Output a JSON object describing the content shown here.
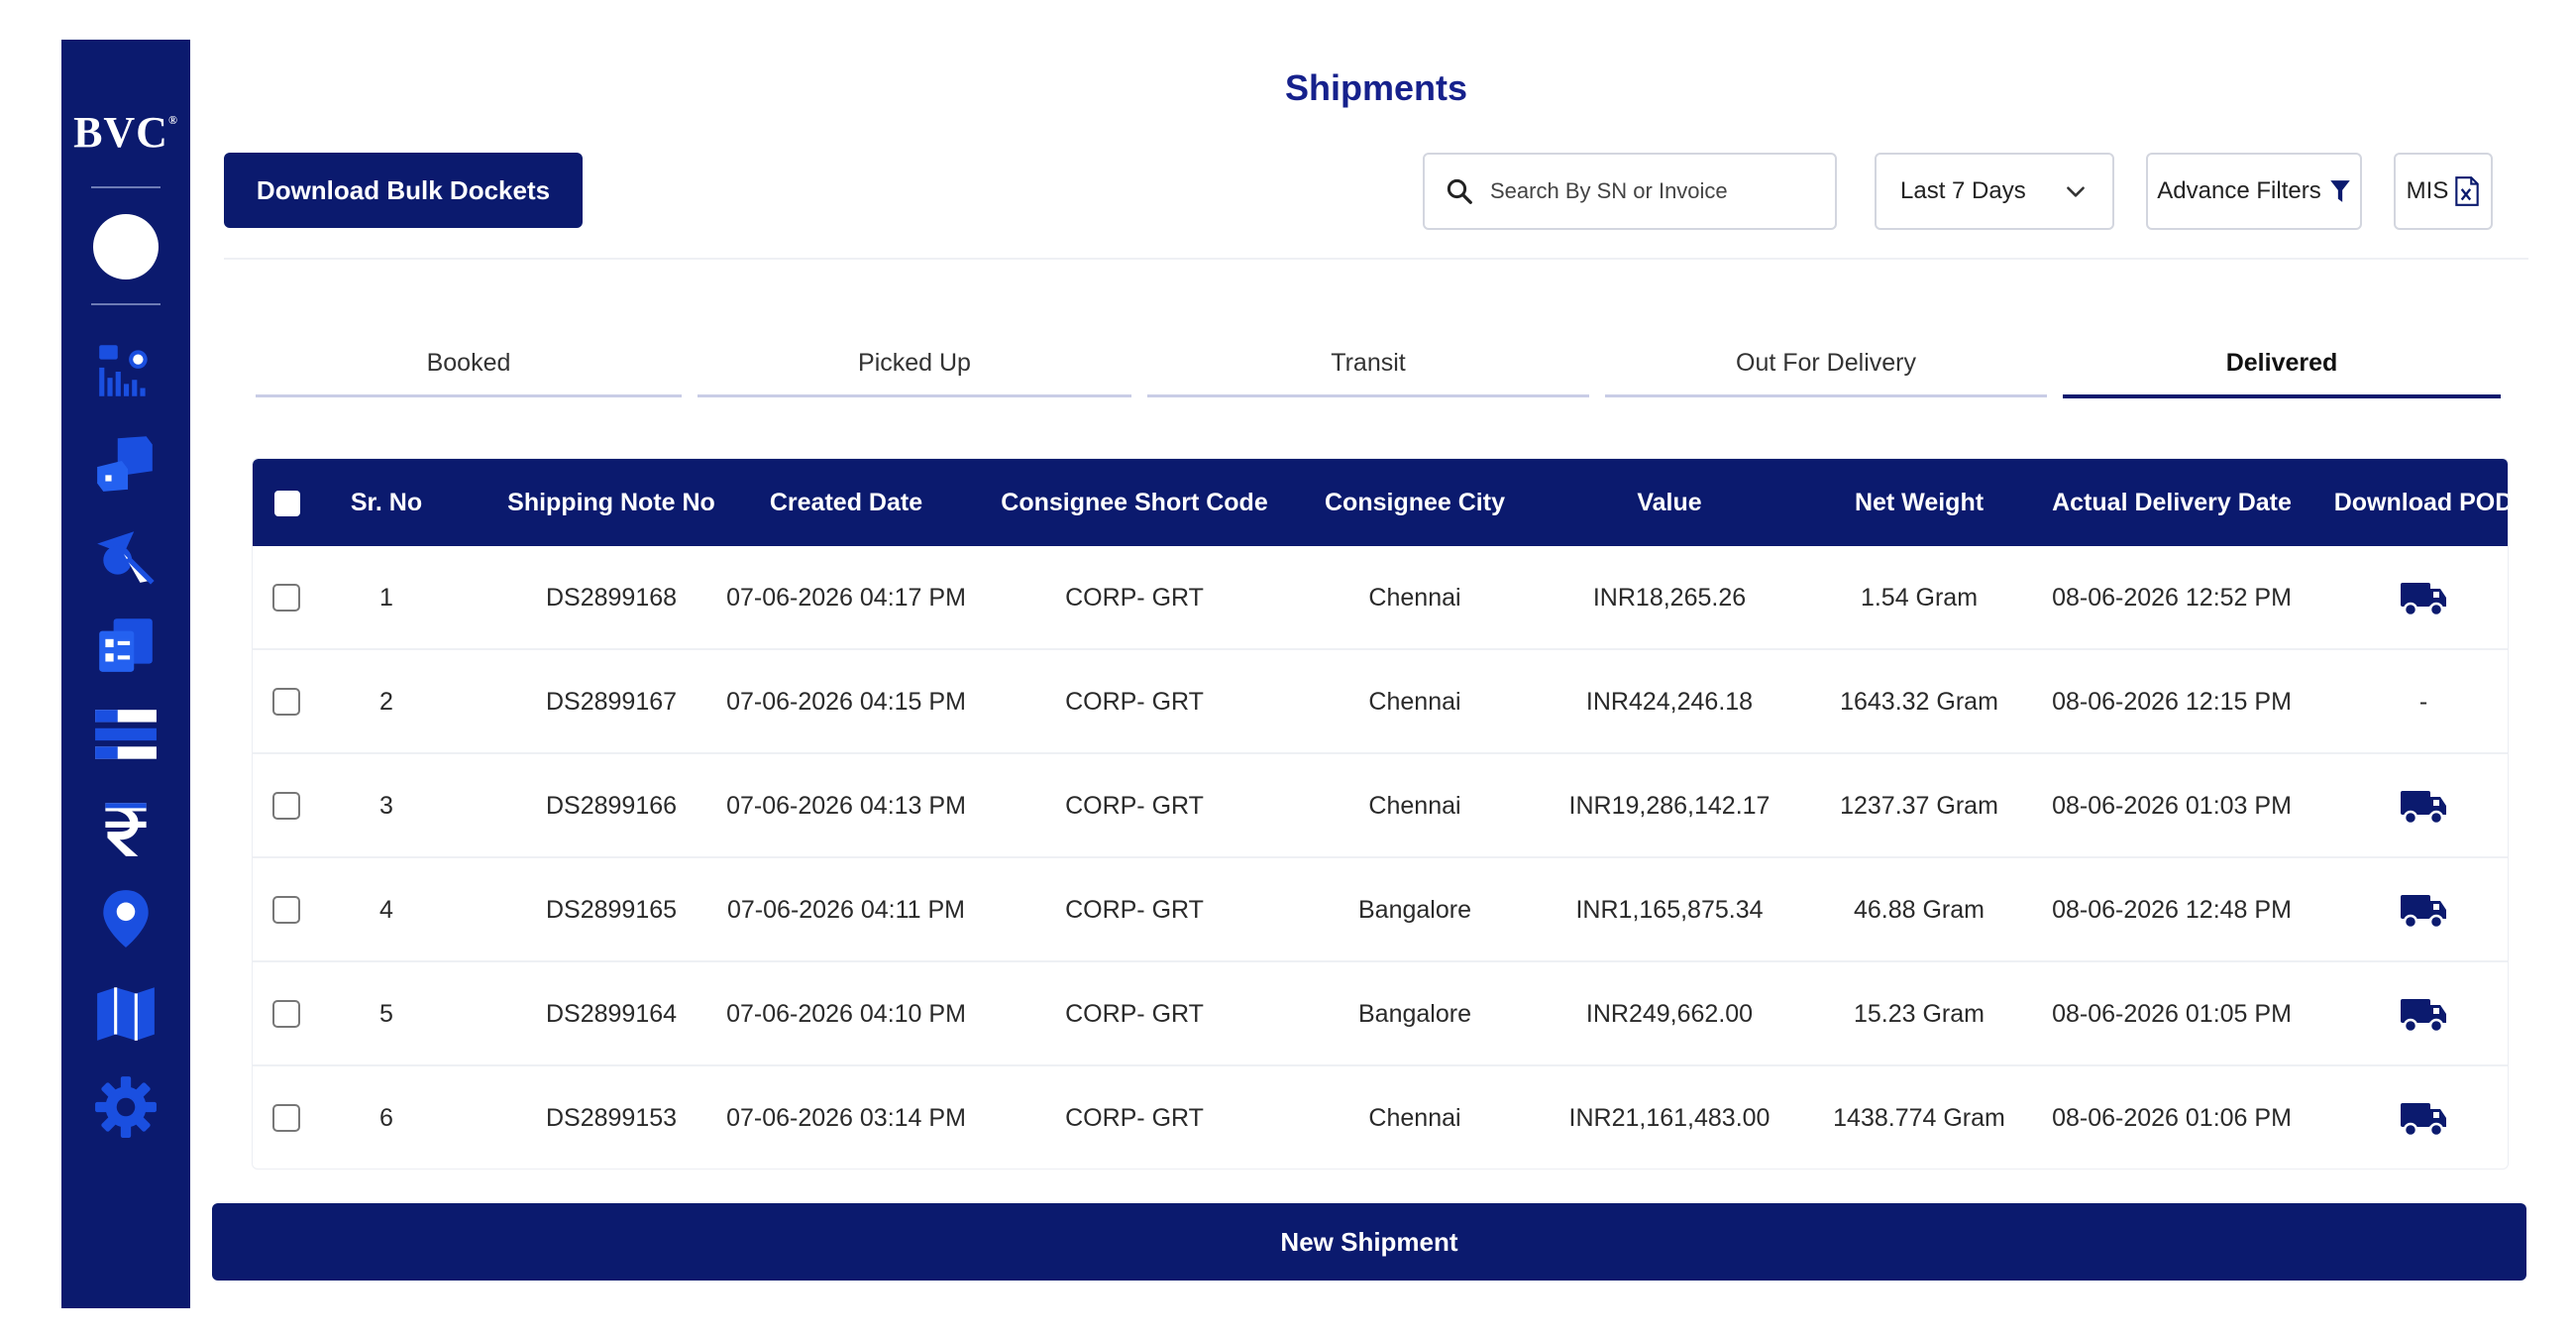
{
  "brand": {
    "logo_text": "BVC",
    "logo_mark": "®"
  },
  "sidebar": {
    "items": [
      {
        "name": "dashboard-icon"
      },
      {
        "name": "shipments-boxes-icon"
      },
      {
        "name": "dispatch-icon"
      },
      {
        "name": "manifest-icon"
      },
      {
        "name": "list-icon"
      },
      {
        "name": "rupee-icon"
      },
      {
        "name": "location-pin-icon"
      },
      {
        "name": "map-icon"
      },
      {
        "name": "settings-gear-icon"
      }
    ]
  },
  "header": {
    "title": "Shipments",
    "bulk_button": "Download Bulk Dockets",
    "search_placeholder": "Search By SN or Invoice",
    "date_filter": "Last 7 Days",
    "advance_filters": "Advance Filters",
    "mis": "MIS"
  },
  "tabs": [
    {
      "label": "Booked"
    },
    {
      "label": "Picked Up"
    },
    {
      "label": "Transit"
    },
    {
      "label": "Out For Delivery"
    },
    {
      "label": "Delivered",
      "active": true
    }
  ],
  "table": {
    "columns": [
      "Sr. No",
      "Shipping Note No",
      "Created Date",
      "Consignee Short Code",
      "Consignee City",
      "Value",
      "Net Weight",
      "Actual Delivery Date",
      "Download POD"
    ],
    "rows": [
      {
        "sr": "1",
        "sn": "DS2899168",
        "created": "07-06-2026 04:17 PM",
        "code": "CORP- GRT",
        "city": "Chennai",
        "value": "INR18,265.26",
        "weight": "1.54 Gram",
        "delivered": "08-06-2026 12:52 PM",
        "pod": "truck"
      },
      {
        "sr": "2",
        "sn": "DS2899167",
        "created": "07-06-2026 04:15 PM",
        "code": "CORP- GRT",
        "city": "Chennai",
        "value": "INR424,246.18",
        "weight": "1643.32 Gram",
        "delivered": "08-06-2026 12:15 PM",
        "pod": "-"
      },
      {
        "sr": "3",
        "sn": "DS2899166",
        "created": "07-06-2026 04:13 PM",
        "code": "CORP- GRT",
        "city": "Chennai",
        "value": "INR19,286,142.17",
        "weight": "1237.37 Gram",
        "delivered": "08-06-2026 01:03 PM",
        "pod": "truck"
      },
      {
        "sr": "4",
        "sn": "DS2899165",
        "created": "07-06-2026 04:11 PM",
        "code": "CORP- GRT",
        "city": "Bangalore",
        "value": "INR1,165,875.34",
        "weight": "46.88 Gram",
        "delivered": "08-06-2026 12:48 PM",
        "pod": "truck"
      },
      {
        "sr": "5",
        "sn": "DS2899164",
        "created": "07-06-2026 04:10 PM",
        "code": "CORP- GRT",
        "city": "Bangalore",
        "value": "INR249,662.00",
        "weight": "15.23 Gram",
        "delivered": "08-06-2026 01:05 PM",
        "pod": "truck"
      },
      {
        "sr": "6",
        "sn": "DS2899153",
        "created": "07-06-2026 03:14 PM",
        "code": "CORP- GRT",
        "city": "Chennai",
        "value": "INR21,161,483.00",
        "weight": "1438.774 Gram",
        "delivered": "08-06-2026 01:06 PM",
        "pod": "truck"
      }
    ]
  },
  "footer": {
    "new_shipment": "New Shipment"
  },
  "colors": {
    "primary": "#0b1a6e",
    "icon_blue": "#1a4fe0",
    "title": "#16218c"
  }
}
